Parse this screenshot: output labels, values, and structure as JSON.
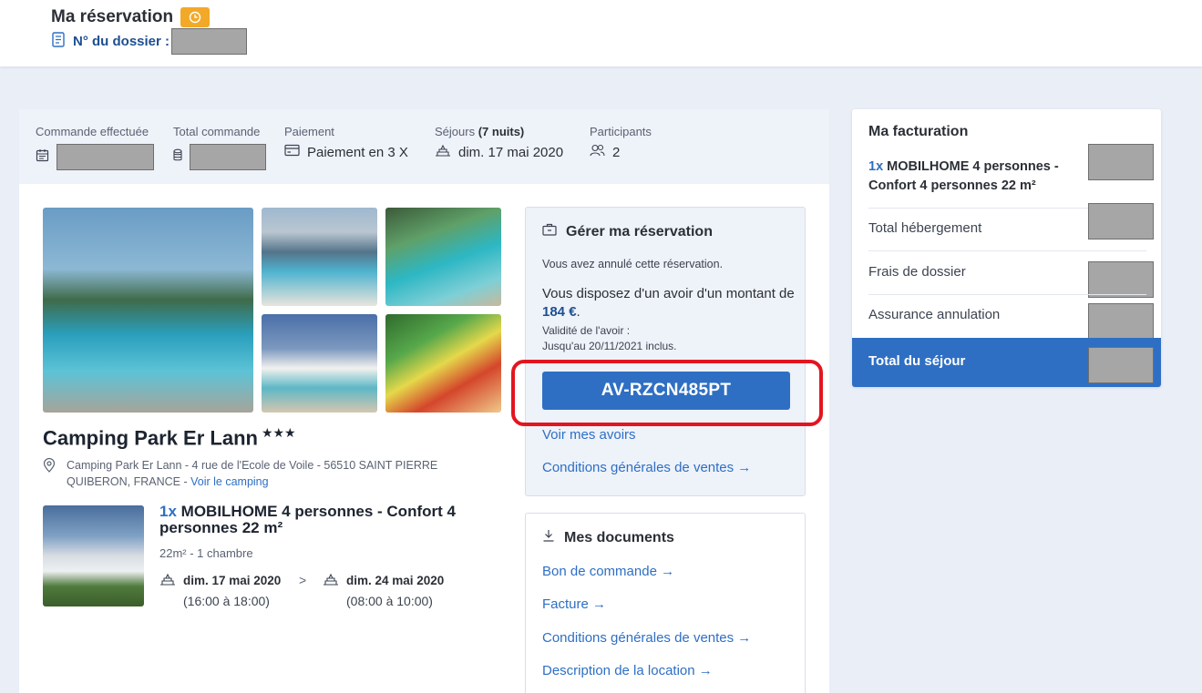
{
  "header": {
    "title": "Ma réservation",
    "dossier_label": "N° du dossier :"
  },
  "summary": {
    "commande_label": "Commande effectuée",
    "total_label": "Total commande",
    "paiement_label": "Paiement",
    "paiement_value": "Paiement en 3 X",
    "sejours_label": "Séjours",
    "sejours_nights": "(7 nuits)",
    "sejours_value": "dim. 17 mai 2020",
    "participants_label": "Participants",
    "participants_value": "2"
  },
  "camping": {
    "name": "Camping Park Er Lann",
    "stars": "★★★",
    "address": "Camping Park Er Lann - 4 rue de l'Ecole de Voile - 56510 SAINT PIERRE QUIBERON, FRANCE - ",
    "voir_link": "Voir le camping"
  },
  "unit": {
    "qty": "1x",
    "title": "MOBILHOME 4 personnes - Confort 4 personnes 22 m²",
    "sub": "22m² - 1 chambre",
    "arrival_date": "dim. 17 mai 2020",
    "arrival_time": "(16:00 à 18:00)",
    "separator": ">",
    "departure_date": "dim. 24 mai 2020",
    "departure_time": "(08:00 à 10:00)"
  },
  "manage": {
    "title": "Gérer ma réservation",
    "info": "Vous avez annulé cette réservation.",
    "avoir_text": "Vous disposez d'un avoir d'un montant de ",
    "avoir_amount": "184 €",
    "avoir_end": ".",
    "valid_line1": "Validité de l'avoir :",
    "valid_line2": "Jusqu'au 20/11/2021 inclus.",
    "code": "AV-RZCN485PT",
    "link_avoirs": "Voir mes avoirs",
    "link_cgv": "Conditions générales de ventes →"
  },
  "documents": {
    "title": "Mes documents",
    "links": [
      "Bon de commande →",
      "Facture →",
      "Conditions générales de ventes →",
      "Description de la location →"
    ]
  },
  "billing": {
    "title": "Ma facturation",
    "qty": "1x",
    "item": "MOBILHOME 4 personnes - Confort 4 personnes 22 m²",
    "rows": [
      "Total hébergement",
      "Frais de dossier",
      "Assurance annulation"
    ],
    "total_label": "Total du séjour"
  },
  "colors": {
    "accent": "#2e6fc4",
    "badge": "#f2a928",
    "highlight": "#e3151f"
  }
}
